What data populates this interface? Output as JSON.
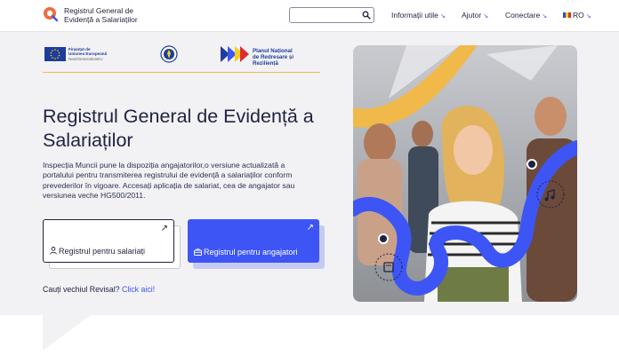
{
  "header": {
    "logo_line1": "Registrul General de",
    "logo_line2": "Evidență a Salariaților",
    "search_placeholder": "",
    "nav": [
      {
        "label": "Informații utile",
        "chevron": "↘"
      },
      {
        "label": "Ajutor",
        "chevron": "↘"
      },
      {
        "label": "Conectare",
        "chevron": "↘"
      },
      {
        "label": "RO",
        "chevron": "↘"
      }
    ]
  },
  "partners": {
    "eu_line1": "Finanțat de",
    "eu_line2": "Uniunea Europeană",
    "eu_line3": "NextGenerationEU",
    "pnrr_line1": "Planul Național",
    "pnrr_line2": "de Redresare și Reziliență"
  },
  "hero": {
    "title": "Registrul General de Evidență a Salariaților",
    "description": "Inspecția Muncii pune la dispoziția angajatorilor,o versiune actualizată a portalului pentru transmiterea registrului de evidență a salariaților conform prevederilor în vigoare. Accesați aplicația de salariat, cea de angajator sau versiunea veche HG500/2011.",
    "card_employees": "Registrul pentru salariați",
    "card_employers": "Registrul pentru angajatori",
    "card_arrow": "↗",
    "revisal_prompt": "Cauți vechiul Revisal?",
    "revisal_link": "Click aici!"
  },
  "colors": {
    "accent": "#3d55f5",
    "navy": "#1f2240",
    "orange": "#f0b94a",
    "hero_bg": "#f2f2f5"
  },
  "icons": [
    "search-icon",
    "user-icon",
    "briefcase-icon",
    "arrow-up-right-icon",
    "chevron-down-icon",
    "music-note-icon",
    "book-icon"
  ]
}
